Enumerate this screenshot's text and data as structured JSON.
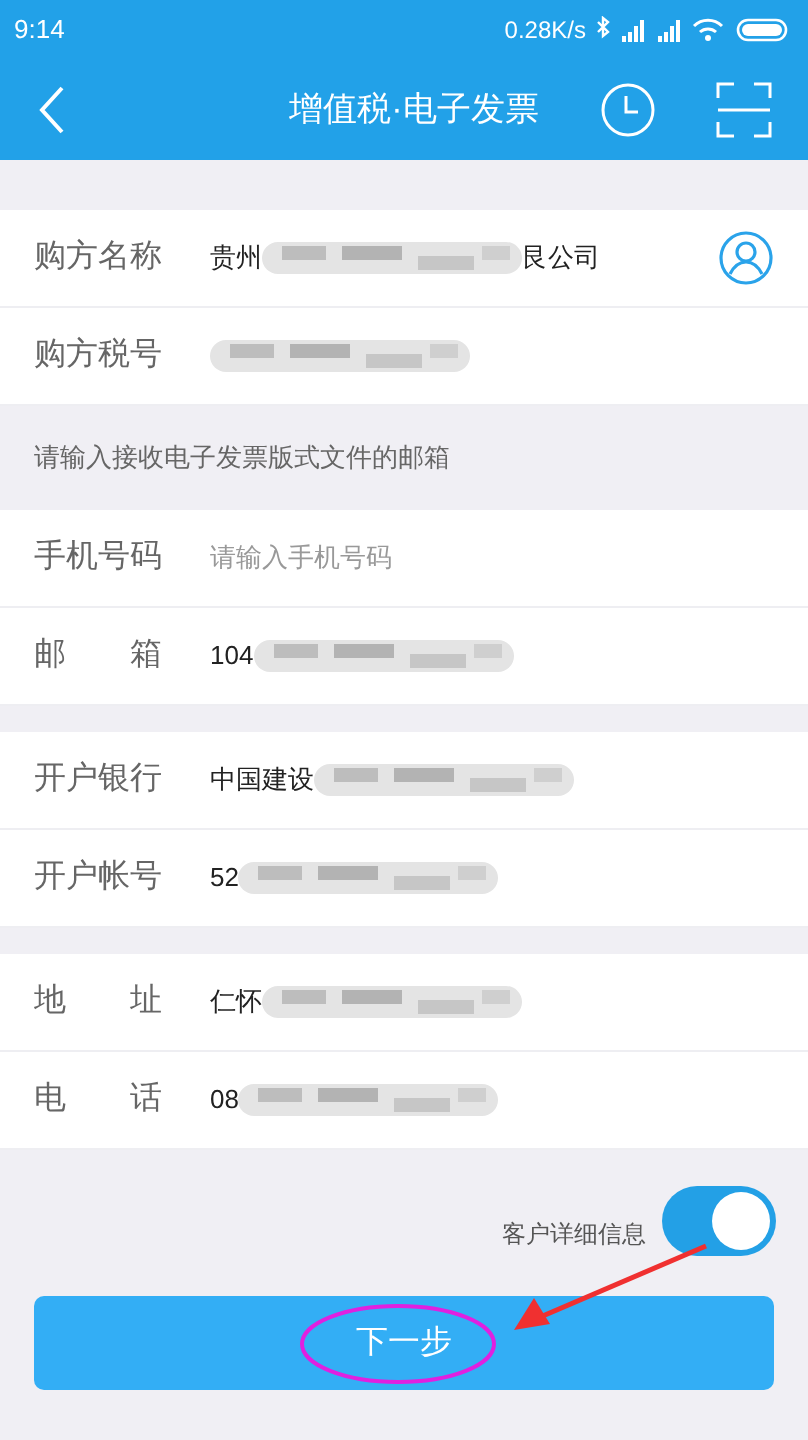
{
  "status_bar": {
    "time": "9:14",
    "speed": "0.28K/s"
  },
  "nav": {
    "title": "增值税·电子发票"
  },
  "groups": [
    {
      "rows": [
        {
          "label": "购方名称",
          "value": "贵州",
          "suffix": "艮公司",
          "redacted": true,
          "contact_button": true
        },
        {
          "label": "购方税号",
          "value": "",
          "suffix": "",
          "redacted": true,
          "contact_button": false
        }
      ],
      "note": "请输入接收电子发票版式文件的邮箱"
    },
    {
      "rows": [
        {
          "label": "手机号码",
          "placeholder": "请输入手机号码",
          "redacted": false,
          "contact_button": false
        },
        {
          "label": "邮　　箱",
          "value": "104",
          "suffix": "",
          "redacted": true,
          "contact_button": false
        }
      ]
    },
    {
      "rows": [
        {
          "label": "开户银行",
          "value": "中国建设",
          "suffix": "",
          "redacted": true,
          "contact_button": false
        },
        {
          "label": "开户帐号",
          "value": "52",
          "suffix": "",
          "redacted": true,
          "contact_button": false
        }
      ]
    },
    {
      "rows": [
        {
          "label": "地　　址",
          "value": "仁怀",
          "suffix": "",
          "redacted": true,
          "contact_button": false
        },
        {
          "label": "电　　话",
          "value": "08",
          "suffix": "",
          "redacted": true,
          "contact_button": false
        }
      ]
    }
  ],
  "detail_toggle": {
    "label": "客户详细信息",
    "on": true
  },
  "next_button": {
    "label": "下一步"
  }
}
